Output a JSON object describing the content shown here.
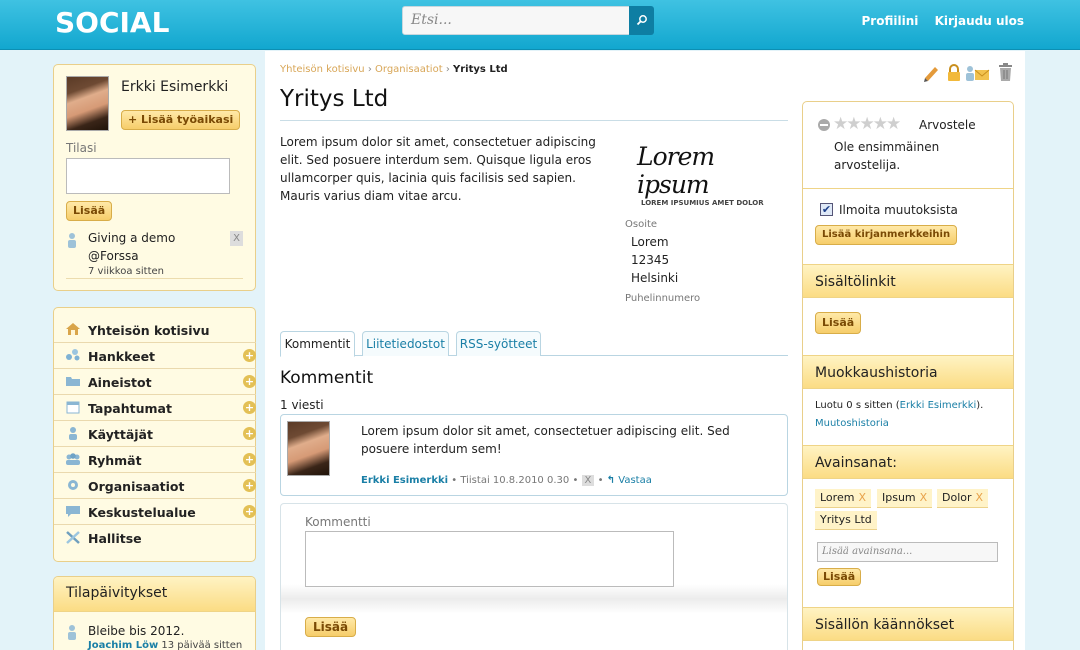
{
  "header": {
    "logo": "SOCIAL",
    "search_placeholder": "Etsi...",
    "profile_link": "Profiilini",
    "logout_link": "Kirjaudu ulos"
  },
  "user_box": {
    "name": "Erkki Esimerkki",
    "add_worktime": "+ Lisää työaikasi",
    "status_label": "Tilasi",
    "add_button": "Lisää",
    "activity_text": "Giving a demo",
    "activity_place": "@Forssa",
    "activity_time": "7 viikkoa sitten",
    "remove": "X"
  },
  "sidebar": {
    "items": [
      {
        "label": "Yhteisön kotisivu",
        "icon": "home-icon"
      },
      {
        "label": "Hankkeet",
        "icon": "projects-icon"
      },
      {
        "label": "Aineistot",
        "icon": "folder-icon"
      },
      {
        "label": "Tapahtumat",
        "icon": "calendar-icon"
      },
      {
        "label": "Käyttäjät",
        "icon": "user-icon"
      },
      {
        "label": "Ryhmät",
        "icon": "group-icon"
      },
      {
        "label": "Organisaatiot",
        "icon": "gear-icon"
      },
      {
        "label": "Keskustelualue",
        "icon": "chat-icon"
      },
      {
        "label": "Hallitse",
        "icon": "tools-icon"
      }
    ]
  },
  "status_updates": {
    "title": "Tilapäivitykset",
    "item_text": "Bleibe bis 2012.",
    "item_author": "Joachim Löw",
    "item_time": "13 päivää sitten"
  },
  "breadcrumb": {
    "home": "Yhteisön kotisivu",
    "section": "Organisaatiot",
    "current": "Yritys Ltd",
    "sep": "›"
  },
  "page": {
    "title": "Yritys Ltd",
    "description": "Lorem ipsum dolor sit amet, consectetuer adipiscing elit. Sed posuere interdum sem. Quisque ligula eros ullamcorper quis, lacinia quis facilisis sed sapien. Mauris varius diam vitae arcu.",
    "logo_text": "Lorem ipsum",
    "logo_sub_left": "LOREM IPSUMIUS",
    "logo_sub_right": "AMET DOLOR",
    "address_label": "Osoite",
    "address_line1": "Lorem",
    "address_line2": "12345",
    "address_line3": "Helsinki",
    "phone_label": "Puhelinnumero"
  },
  "tabs": [
    "Kommentit",
    "Liitetiedostot",
    "RSS-syötteet"
  ],
  "comments": {
    "title": "Kommentit",
    "count": "1 viesti",
    "text": "Lorem ipsum dolor sit amet, consectetuer adipiscing elit. Sed posuere interdum sem!",
    "author": "Erkki Esimerkki",
    "date": "Tiistai 10.8.2010 0.30",
    "remove": "X",
    "reply": "Vastaa",
    "bullet": "•",
    "form_label": "Kommentti",
    "submit": "Lisää"
  },
  "right": {
    "rate_label": "Arvostele",
    "rate_sub": "Ole ensimmäinen arvostelija.",
    "rating": 0,
    "notify_label": "Ilmoita muutoksista",
    "bookmark_btn": "Lisää kirjanmerkkeihin",
    "links_title": "Sisältölinkit",
    "links_btn": "Lisää",
    "history_title": "Muokkaushistoria",
    "history_prefix": "Luotu 0 s sitten (",
    "history_author": "Erkki Esimerkki",
    "history_suffix": ").",
    "history_link": "Muutoshistoria",
    "tags_title": "Avainsanat:",
    "tags": [
      "Lorem",
      "Ipsum",
      "Dolor",
      "Yritys Ltd"
    ],
    "tag_remove": "X",
    "tag_placeholder": "Lisää avainsana...",
    "tag_btn": "Lisää",
    "translations_title": "Sisällön käännökset"
  },
  "colors": {
    "topbar": "#12a7cf",
    "accent": "#f6cd6a",
    "link": "#1a7fa6"
  }
}
